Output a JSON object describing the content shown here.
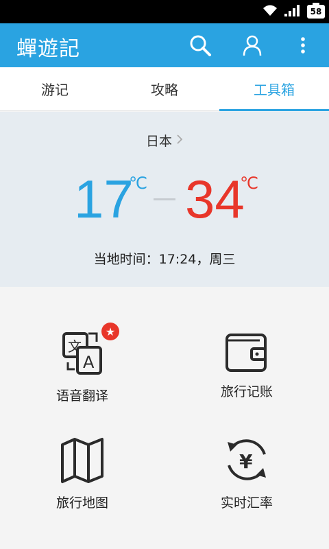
{
  "status_bar": {
    "battery_level": "58",
    "icons": [
      "wifi-icon",
      "signal-icon",
      "battery-icon"
    ]
  },
  "app_bar": {
    "title": "蟬遊記",
    "icons": [
      "search-icon",
      "user-icon",
      "more-vert-icon"
    ]
  },
  "tabs": [
    {
      "label": "游记",
      "active": false
    },
    {
      "label": "攻略",
      "active": false
    },
    {
      "label": "工具箱",
      "active": true
    }
  ],
  "weather": {
    "country": "日本",
    "temp_low": "17",
    "temp_high": "34",
    "unit": "℃",
    "local_time": "当地时间：17:24，周三"
  },
  "tools": [
    {
      "label": "语音翻译",
      "icon": "translate-icon",
      "badge": "★"
    },
    {
      "label": "旅行记账",
      "icon": "wallet-icon"
    },
    {
      "label": "旅行地图",
      "icon": "map-icon"
    },
    {
      "label": "实时汇率",
      "icon": "exchange-rate-icon"
    }
  ],
  "colors": {
    "accent": "#2aa3e1",
    "temp_high": "#e8362a",
    "badge": "#e8362a",
    "weather_bg": "#e6ecf1"
  }
}
